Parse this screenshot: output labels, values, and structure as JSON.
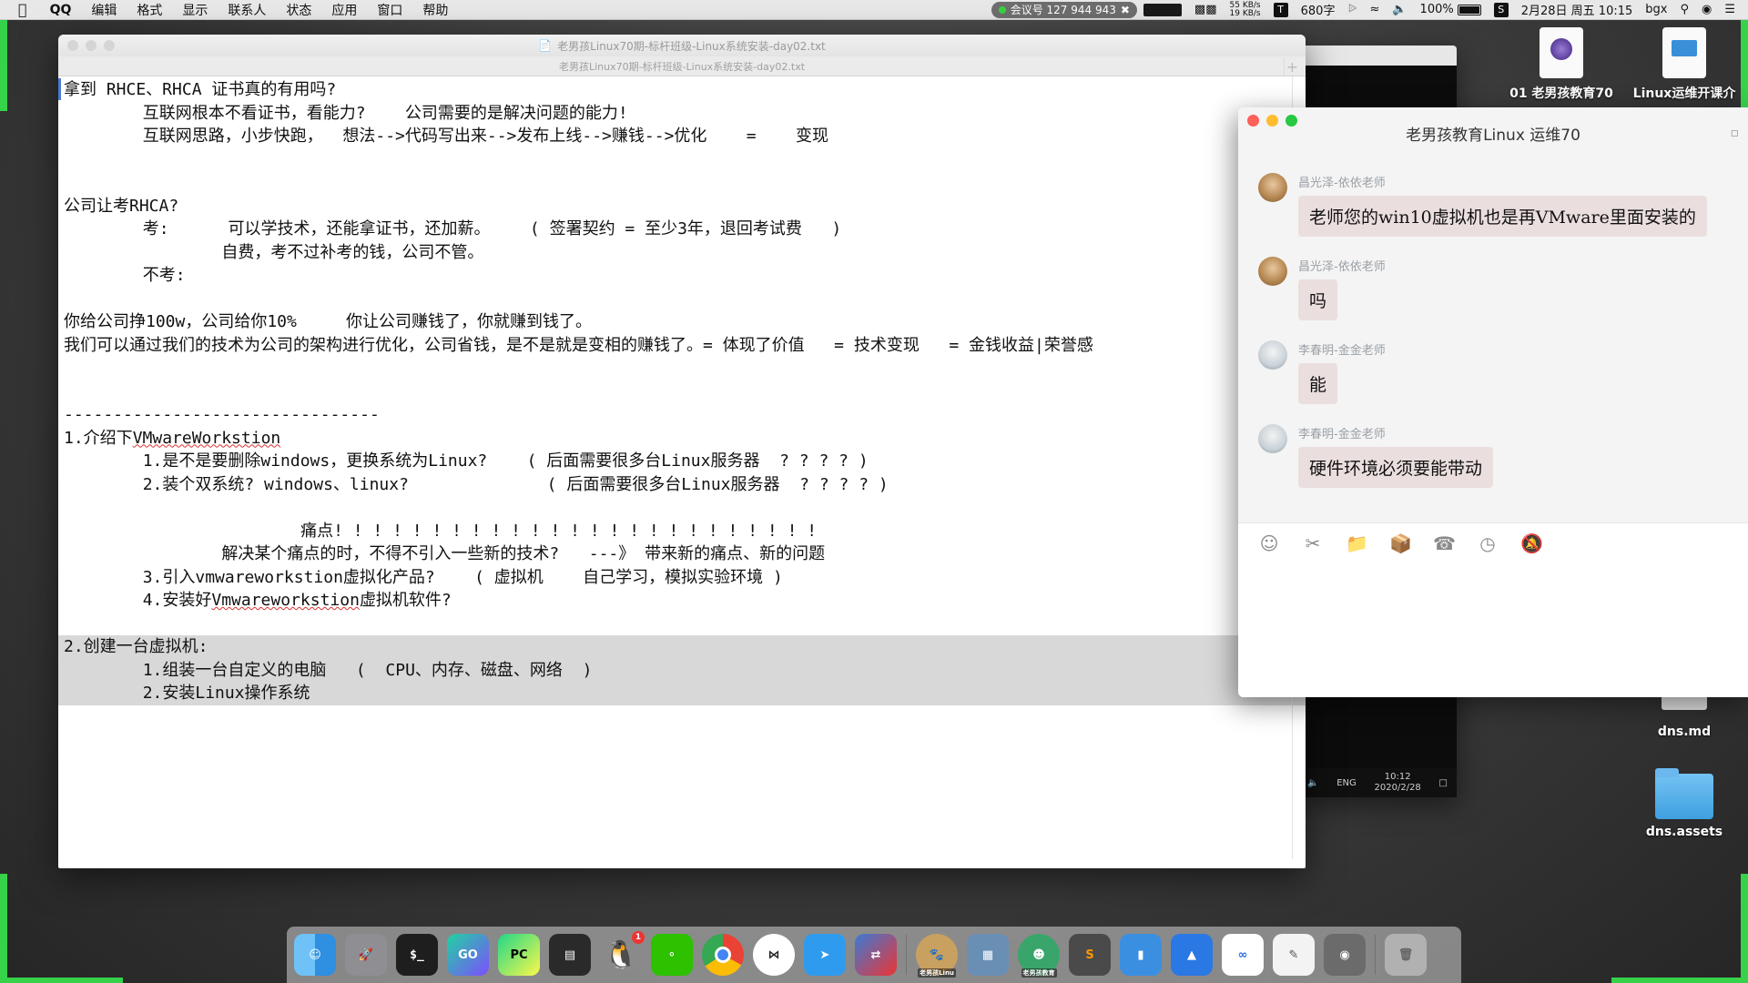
{
  "menubar": {
    "app": "QQ",
    "items": [
      "编辑",
      "格式",
      "显示",
      "联系人",
      "状态",
      "应用",
      "窗口",
      "帮助"
    ],
    "meeting": "会议号 127 944 943",
    "net_up": "55 KB/s",
    "net_down": "19 KB/s",
    "chars": "680字",
    "battery": "100%",
    "datetime": "2月28日 周五 10:15",
    "user": "bgx"
  },
  "editor": {
    "title": "老男孩Linux70期-标杆班级-Linux系统安装-day02.txt",
    "tab": "老男孩Linux70期-标杆班级-Linux系统安装-day02.txt",
    "lines": [
      "拿到 RHCE、RHCA 证书真的有用吗?",
      "        互联网根本不看证书，看能力?    公司需要的是解决问题的能力!",
      "        互联网思路，小步快跑，  想法-->代码写出来-->发布上线-->赚钱-->优化    =    变现",
      "",
      "",
      "公司让考RHCA?",
      "        考:      可以学技术，还能拿证书，还加薪。    ( 签署契约 = 至少3年，退回考试费   )",
      "                自费，考不过补考的钱，公司不管。",
      "        不考:",
      "",
      "你给公司挣100w，公司给你10%     你让公司赚钱了，你就赚到钱了。",
      "我们可以通过我们的技术为公司的架构进行优化，公司省钱，是不是就是变相的赚钱了。= 体现了价值   = 技术变现   = 金钱收益|荣誉感",
      "",
      "",
      "--------------------------------",
      "1.介绍下VMwareWorkstion",
      "        1.是不是要删除windows，更换系统为Linux?    ( 后面需要很多台Linux服务器  ? ? ? ? )",
      "        2.装个双系统? windows、linux?              ( 后面需要很多台Linux服务器  ? ? ? ? )",
      "",
      "                        痛点! ! ! ! ! ! ! ! ! ! ! ! ! ! ! ! ! ! ! ! ! ! ! ! !",
      "                解决某个痛点的时，不得不引入一些新的技术?   ---》 带来新的痛点、新的问题",
      "        3.引入vmwareworkstion虚拟化产品?    ( 虚拟机    自己学习，模拟实验环境 )",
      "        4.安装好Vmwareworkstion虚拟机软件?",
      "",
      "2.创建一台虚拟机:",
      "        1.组装一台自定义的电脑   (  CPU、内存、磁盘、网络  )",
      "        2.安装Linux操作系统"
    ]
  },
  "darkwin": {
    "ime": "ENG",
    "time": "10:12",
    "date": "2020/2/28"
  },
  "chat": {
    "title": "老男孩教育Linux 运维70",
    "messages": [
      {
        "sender": "昌光泽-依依老师",
        "text": "老师您的win10虚拟机也是再VMware里面安装的"
      },
      {
        "sender": "昌光泽-依依老师",
        "text": "吗"
      },
      {
        "sender": "李春明-金金老师",
        "text": "能"
      },
      {
        "sender": "李春明-金金老师",
        "text": "硬件环境必须要能带动"
      }
    ]
  },
  "desktop": {
    "icons": [
      "01 老男孩教育70",
      "Linux运维开课介",
      "dns.md",
      "dns.assets"
    ]
  },
  "dock": {
    "apps": [
      "Finder",
      "Launchpad",
      "Terminal",
      "GoLand",
      "PyCharm",
      "Activity",
      "QQ",
      "WeChat",
      "Chrome",
      "Hub",
      "Feishu",
      "Remote",
      "老男孩Linu",
      "VMware",
      "老男孩教育",
      "Sublime",
      "Keynote",
      "Lark",
      "Baidu",
      "TextEdit",
      "Photo",
      "Trash"
    ],
    "qq_badge": "1",
    "label_a": "老男孩Linu",
    "label_b": "老男孩教育"
  },
  "colors": {
    "accent_green": "#35d24a",
    "chat_bubble": "#ebdede",
    "selection": "#d8d8d8"
  }
}
